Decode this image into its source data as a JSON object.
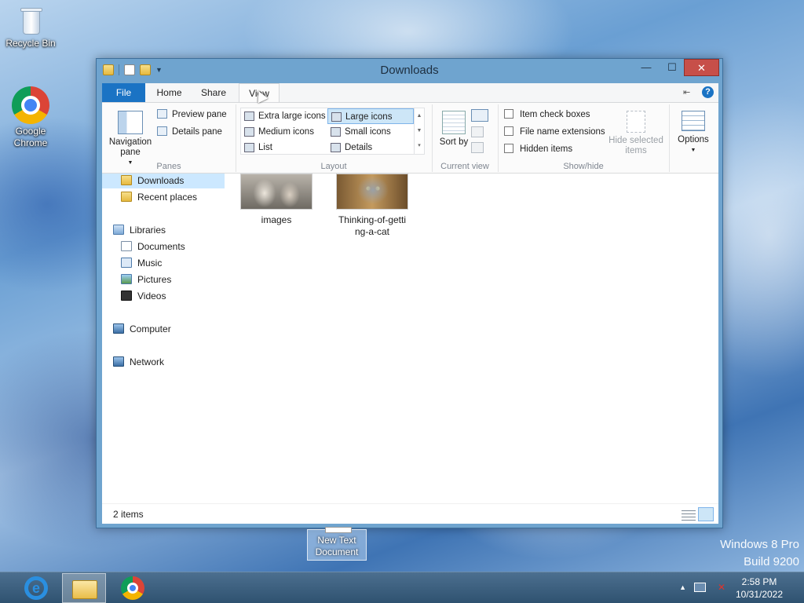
{
  "desktop": {
    "icons": [
      {
        "label": "Recycle Bin"
      },
      {
        "label": "Google Chrome"
      }
    ],
    "drag_item": {
      "label": "New Text Document"
    },
    "watermark": {
      "line1": "Windows 8 Pro",
      "line2": "Build 9200"
    }
  },
  "window": {
    "title": "Downloads",
    "controls": {
      "minimize": "—",
      "maximize": "☐",
      "close": "✕"
    },
    "tabs": [
      {
        "label": "File"
      },
      {
        "label": "Home"
      },
      {
        "label": "Share"
      },
      {
        "label": "View",
        "active": true
      }
    ],
    "ribbon": {
      "panes": {
        "group_label": "Panes",
        "navigation_pane": "Navigation pane",
        "preview_pane": "Preview pane",
        "details_pane": "Details pane"
      },
      "layout": {
        "group_label": "Layout",
        "options": [
          {
            "label": "Extra large icons"
          },
          {
            "label": "Large icons",
            "selected": true
          },
          {
            "label": "Medium icons"
          },
          {
            "label": "Small icons"
          },
          {
            "label": "List"
          },
          {
            "label": "Details"
          }
        ]
      },
      "current_view": {
        "group_label": "Current view",
        "sort_by": "Sort by"
      },
      "show_hide": {
        "group_label": "Show/hide",
        "item_check_boxes": "Item check boxes",
        "file_name_extensions": "File name extensions",
        "hidden_items": "Hidden items",
        "hide_selected_items": "Hide selected items"
      },
      "options": "Options"
    },
    "nav_pane": {
      "items": [
        {
          "label": "Downloads",
          "selected": true,
          "icon": "downloads-folder-icon"
        },
        {
          "label": "Recent places",
          "icon": "recent-places-icon"
        },
        {
          "label": "Libraries",
          "icon": "libraries-icon"
        },
        {
          "label": "Documents",
          "icon": "documents-icon"
        },
        {
          "label": "Music",
          "icon": "music-icon"
        },
        {
          "label": "Pictures",
          "icon": "pictures-icon"
        },
        {
          "label": "Videos",
          "icon": "videos-icon"
        },
        {
          "label": "Computer",
          "icon": "computer-icon"
        },
        {
          "label": "Network",
          "icon": "network-icon"
        }
      ]
    },
    "files": [
      {
        "name": "images"
      },
      {
        "name": "Thinking-of-getting-a-cat",
        "line1": "Thinking-of-getti",
        "line2": "ng-a-cat"
      }
    ],
    "status": {
      "item_count": "2 items"
    }
  },
  "taskbar": {
    "apps": [
      {
        "name": "internet-explorer"
      },
      {
        "name": "file-explorer",
        "active": true
      },
      {
        "name": "google-chrome"
      }
    ],
    "clock": {
      "time": "2:58 PM",
      "date": "10/31/2022"
    }
  },
  "colors": {
    "accent": "#1a73c4",
    "close": "#c74f49",
    "selection": "#cde6f7"
  }
}
